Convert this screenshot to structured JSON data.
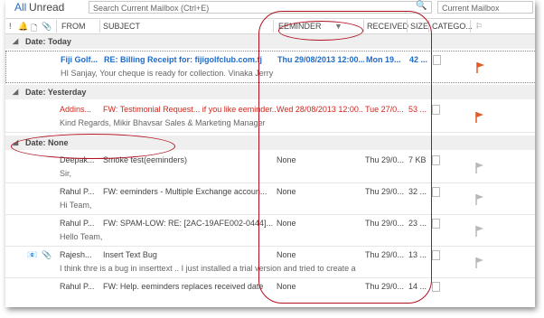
{
  "topbar": {
    "tab_all": "All",
    "tab_unread": "Unread",
    "search_placeholder": "Search Current Mailbox (Ctrl+E)",
    "scope": "Current Mailbox"
  },
  "columns": {
    "from": "FROM",
    "subject": "SUBJECT",
    "reminder": "EEMINDER",
    "received": "RECEIVED",
    "size": "SIZE",
    "category": "CATEGO..."
  },
  "groups": {
    "today": "Date: Today",
    "yesterday": "Date: Yesterday",
    "none": "Date: None"
  },
  "messages": [
    {
      "from": "Fiji Golf...",
      "subject": "RE: Billing Receipt for: fijigolfclub.com.fj",
      "reminder": "Thu 29/08/2013 12:00...",
      "received": "Mon 19...",
      "size": "42 ...",
      "preview": "HI Sanjay,   Your cheque is ready for collection.  Vinaka  Jerry"
    },
    {
      "from": "Addins...",
      "subject": "FW: Testimonial Request... if you like eeminder...",
      "reminder": "Wed 28/08/2013 12:00...",
      "received": "Tue 27/0...",
      "size": "53 ...",
      "preview": "Kind Regards,   Mikir Bhavsar  Sales & Marketing Manager"
    },
    {
      "from": "Deepak...",
      "subject": "Smoke test(eeminders)",
      "reminder": "None",
      "received": "Thu 29/0...",
      "size": "7 KB",
      "preview": "Sir,"
    },
    {
      "from": "Rahul P...",
      "subject": "FW: eeminders - Multiple Exchange accoun...",
      "reminder": "None",
      "received": "Thu 29/0...",
      "size": "32 ...",
      "preview": "Hi Team,"
    },
    {
      "from": "Rahul P...",
      "subject": "FW: SPAM-LOW: RE: [2AC-19AFE002-0444]...",
      "reminder": "None",
      "received": "Thu 29/0...",
      "size": "23 ...",
      "preview": "Hello Team,"
    },
    {
      "from": "Rajesh...",
      "subject": "Insert Text Bug",
      "reminder": "None",
      "received": "Thu 29/0...",
      "size": "13 ...",
      "preview": "I think thre is a bug in inserttext .. I just installed a trial version and tried to create a"
    },
    {
      "from": "Rahul P...",
      "subject": "FW: Help. eeminders replaces received date",
      "reminder": "None",
      "received": "Thu 29/0...",
      "size": "14 ...",
      "preview": ""
    }
  ],
  "colors": {
    "accent_blue": "#1f6bc8",
    "alert_red": "#d0261c",
    "annotation": "#b01020",
    "flag_red": "#e05a28",
    "flag_gray": "#b8b8b8"
  }
}
